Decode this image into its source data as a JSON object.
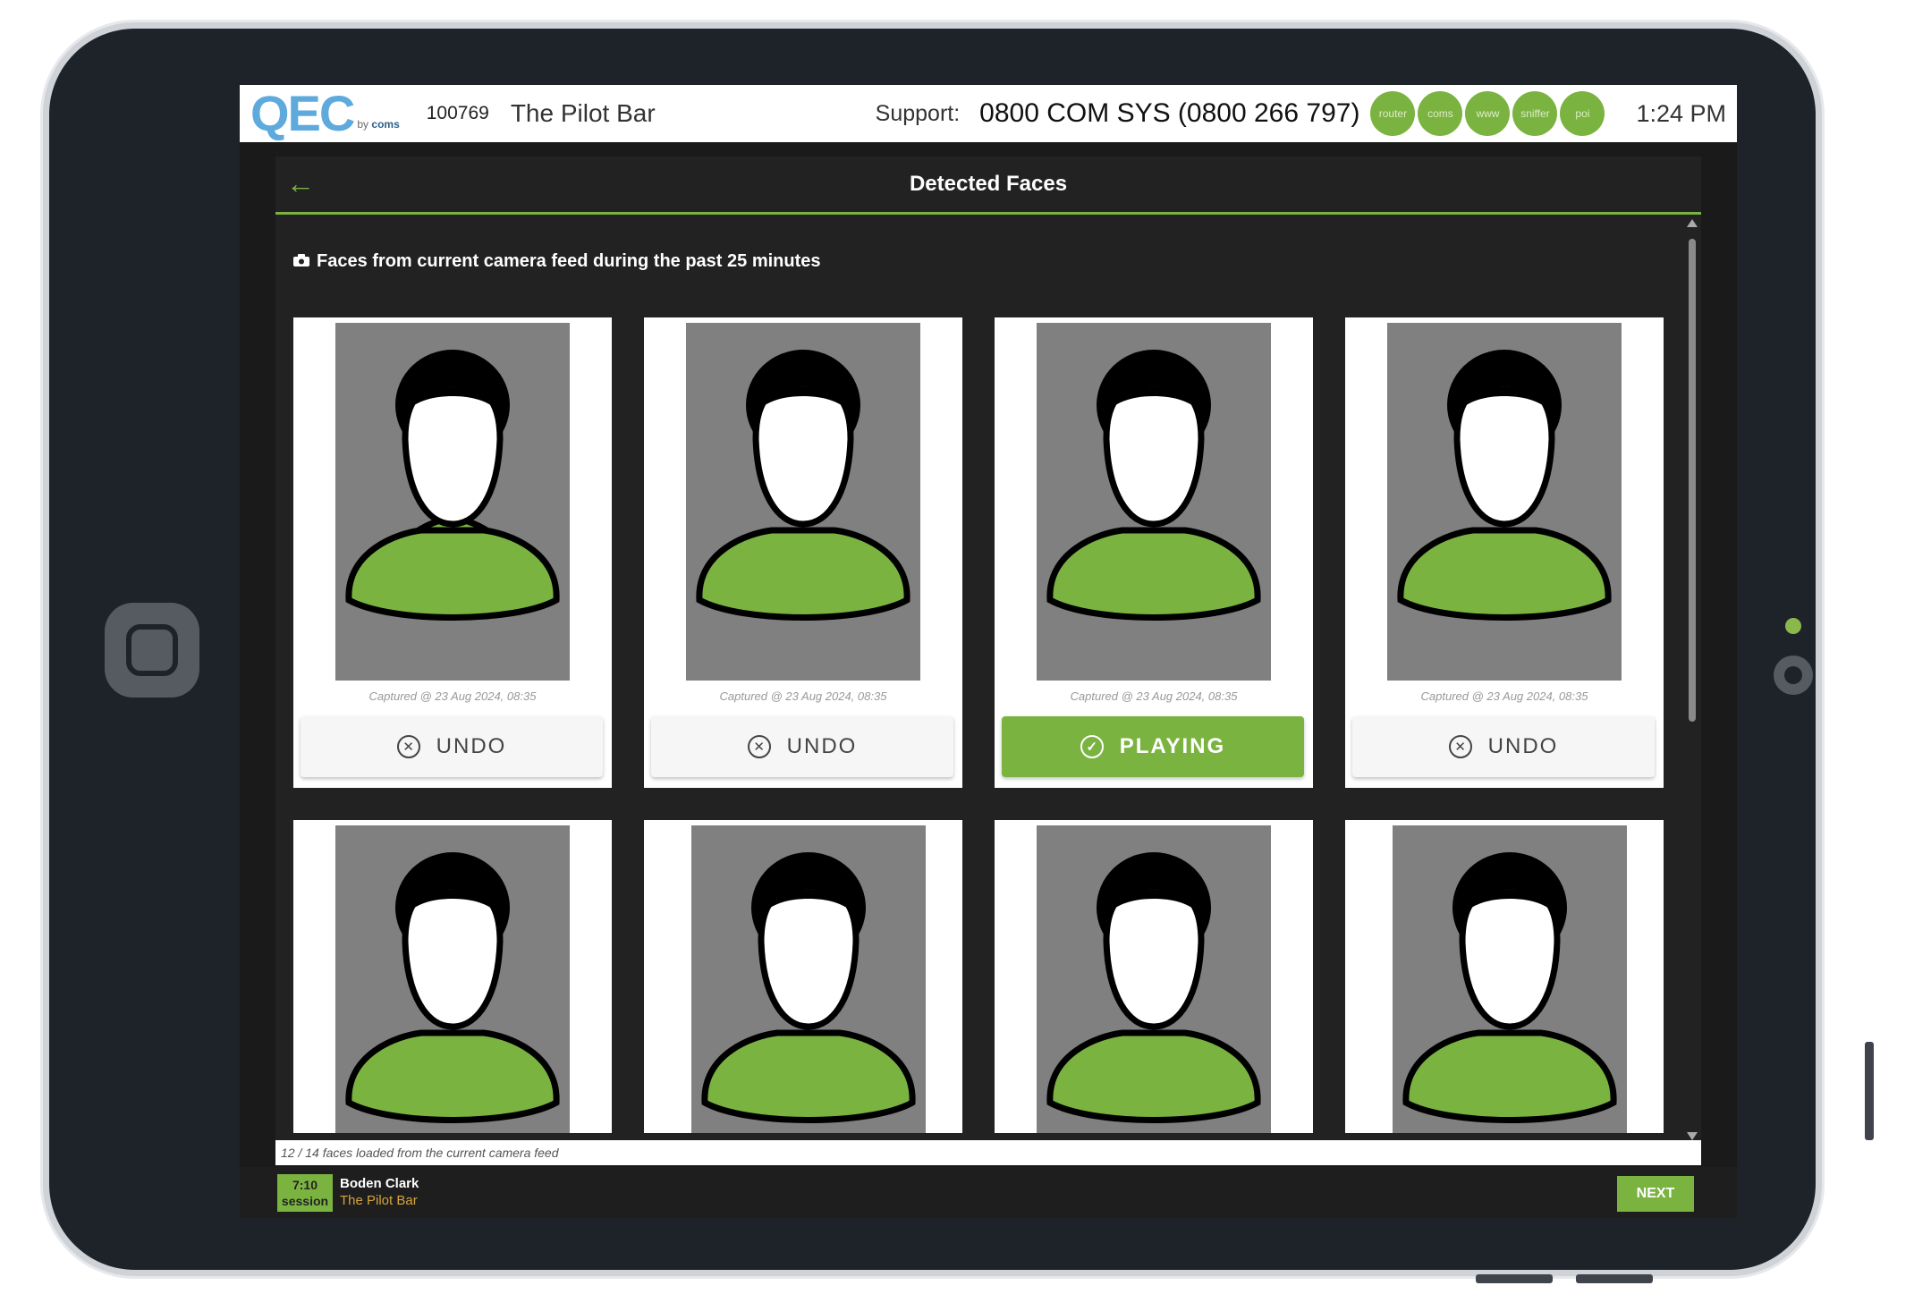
{
  "header": {
    "logo_text": "QEC",
    "logo_sub_prefix": "by",
    "logo_sub_brand": "coms",
    "site_id": "100769",
    "site_name": "The Pilot Bar",
    "support_label": "Support:",
    "support_number": "0800 COM SYS (0800 266 797)",
    "status_indicators": [
      "router",
      "coms",
      "www",
      "sniffer",
      "poi"
    ],
    "time": "1:24 PM"
  },
  "page": {
    "title": "Detected Faces",
    "back_icon": "arrow-left-icon",
    "subtitle": "Faces from current camera feed during the past 25 minutes",
    "subtitle_icon": "camera-icon"
  },
  "faces": [
    {
      "caption": "Captured @ 23 Aug 2024, 08:35",
      "button": "UNDO",
      "state": "undo"
    },
    {
      "caption": "Captured @ 23 Aug 2024, 08:35",
      "button": "UNDO",
      "state": "undo"
    },
    {
      "caption": "Captured @ 23 Aug 2024, 08:35",
      "button": "PLAYING",
      "state": "playing"
    },
    {
      "caption": "Captured @ 23 Aug 2024, 08:35",
      "button": "UNDO",
      "state": "undo"
    },
    {
      "caption": "",
      "button": "",
      "state": "partial"
    },
    {
      "caption": "",
      "button": "",
      "state": "partial"
    },
    {
      "caption": "",
      "button": "",
      "state": "partial"
    },
    {
      "caption": "",
      "button": "",
      "state": "partial"
    }
  ],
  "footer": {
    "loaded_text": "12 / 14 faces loaded from the current camera feed",
    "session_time": "7:10",
    "session_label": "session",
    "user_name": "Boden Clark",
    "user_site": "The Pilot Bar",
    "next_label": "NEXT"
  },
  "colors": {
    "accent": "#7bb341",
    "logo": "#5eaadd",
    "dark": "#222222",
    "site_text": "#d6a53b"
  }
}
